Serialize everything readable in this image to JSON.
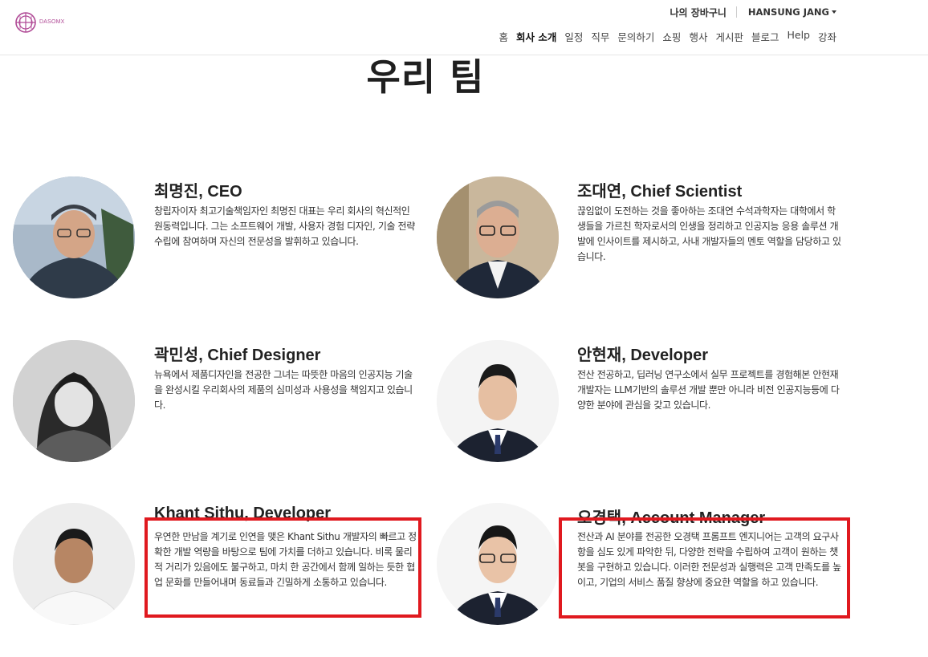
{
  "header": {
    "logo_text": "DASOMX",
    "cart_label": "나의 장바구니",
    "user_label": "HANSUNG JANG",
    "nav": [
      {
        "label": "홈",
        "active": false
      },
      {
        "label": "회사 소개",
        "active": true
      },
      {
        "label": "일정",
        "active": false
      },
      {
        "label": "직무",
        "active": false
      },
      {
        "label": "문의하기",
        "active": false
      },
      {
        "label": "쇼핑",
        "active": false
      },
      {
        "label": "행사",
        "active": false
      },
      {
        "label": "게시판",
        "active": false
      },
      {
        "label": "블로그",
        "active": false
      },
      {
        "label": "Help",
        "active": false
      },
      {
        "label": "강좌",
        "active": false
      }
    ]
  },
  "page": {
    "title": "우리 팀"
  },
  "members": [
    {
      "name": "최명진, CEO",
      "description": "창립자이자 최고기술책임자인 최명진 대표는 우리 회사의 혁신적인 원동력입니다. 그는 소프트웨어 개발, 사용자 경험 디자인, 기술 전략 수립에 참여하며 자신의 전문성을 발휘하고 있습니다."
    },
    {
      "name": "조대연, Chief Scientist",
      "description": "끊임없이 도전하는 것을 좋아하는 조대연 수석과학자는 대학에서 학생들을 가르친 학자로서의 인생을 정리하고 인공지능 응용 솔루션 개발에 인사이트를 제시하고, 사내 개발자들의 멘토 역할을 담당하고 있습니다."
    },
    {
      "name": "곽민성, Chief Designer",
      "description": "뉴욕에서 제품디자인을 전공한 그녀는 따뜻한 마음의 인공지능 기술을 완성시킬 우리회사의 제품의 심미성과 사용성을 책임지고 있습니다."
    },
    {
      "name": "안현재, Developer",
      "description": "전산 전공하고, 딥러닝 연구소에서 실무 프로젝트를 경험해본 안현재 개발자는 LLM기반의 솔루션 개발 뿐만 아니라 비전 인공지능등에 다양한 분야에 관심을 갖고 있습니다."
    },
    {
      "name": "Khant Sithu, Developer",
      "description": "우연한 만남을 계기로 인연을 맺은 Khant Sithu 개발자의 빠르고 정확한 개발 역량을 바탕으로 팀에 가치를 더하고 있습니다. 비록 물리적 거리가 있음에도 불구하고, 마치 한 공간에서 함께 일하는 듯한 협업 문화를 만들어내며 동료들과 긴밀하게 소통하고 있습니다."
    },
    {
      "name": "오경택, Account Manager",
      "description": "전산과 AI 분야를 전공한 오경택 프롬프트 엔지니어는 고객의 요구사항을 심도 있게 파악한 뒤, 다양한 전략을 수립하여 고객이 원하는 챗봇을 구현하고 있습니다. 이러한 전문성과 실행력은 고객 만족도를 높이고, 기업의 서비스 품질 향상에 중요한 역할을 하고 있습니다."
    }
  ],
  "colors": {
    "highlight": "#e0191f",
    "logo": "#b04a96"
  }
}
